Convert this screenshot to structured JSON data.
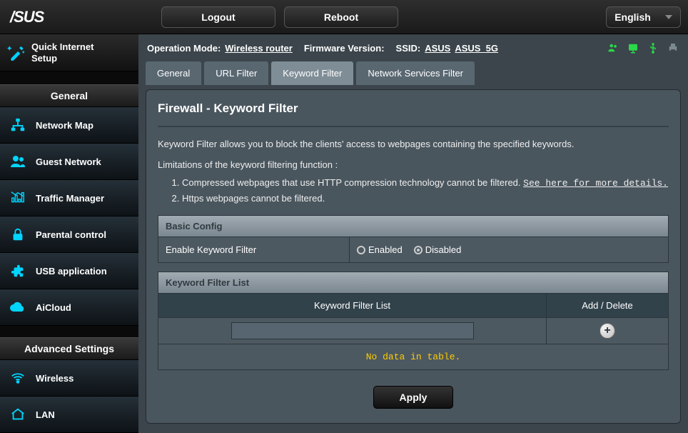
{
  "brand": "/SUS",
  "topbar": {
    "logout": "Logout",
    "reboot": "Reboot",
    "language": "English"
  },
  "status": {
    "op_mode_label": "Operation Mode:",
    "op_mode_value": "Wireless router",
    "fw_label": "Firmware Version:",
    "fw_value": "",
    "ssid_label": "SSID:",
    "ssid_1": "ASUS",
    "ssid_2": "ASUS_5G"
  },
  "qis": {
    "label": "Quick Internet Setup"
  },
  "sidebar": {
    "general_head": "General",
    "advanced_head": "Advanced Settings",
    "general_items": [
      {
        "label": "Network Map",
        "key": "network-map"
      },
      {
        "label": "Guest Network",
        "key": "guest-network"
      },
      {
        "label": "Traffic Manager",
        "key": "traffic-manager"
      },
      {
        "label": "Parental control",
        "key": "parental-control"
      },
      {
        "label": "USB application",
        "key": "usb-application"
      },
      {
        "label": "AiCloud",
        "key": "aicloud"
      }
    ],
    "advanced_items": [
      {
        "label": "Wireless",
        "key": "wireless"
      },
      {
        "label": "LAN",
        "key": "lan"
      }
    ]
  },
  "tabs": [
    {
      "label": "General",
      "active": false
    },
    {
      "label": "URL Filter",
      "active": false
    },
    {
      "label": "Keyword Filter",
      "active": true
    },
    {
      "label": "Network Services Filter",
      "active": false
    }
  ],
  "page": {
    "title": "Firewall - Keyword Filter",
    "description": "Keyword Filter allows you to block the clients' access to webpages containing the specified keywords.",
    "limitations_label": "Limitations of the keyword filtering function :",
    "limitations": {
      "item1_pre": "Compressed webpages that use HTTP compression technology cannot be filtered. ",
      "item1_link": "See here for more details.",
      "item2": "Https webpages cannot be filtered."
    }
  },
  "basic_config": {
    "header": "Basic Config",
    "row_label": "Enable Keyword Filter",
    "opt_enabled": "Enabled",
    "opt_disabled": "Disabled",
    "selected": "disabled"
  },
  "filter_list": {
    "header": "Keyword Filter List",
    "col_keyword": "Keyword Filter List",
    "col_action": "Add / Delete",
    "no_data": "No data in table."
  },
  "apply": "Apply"
}
